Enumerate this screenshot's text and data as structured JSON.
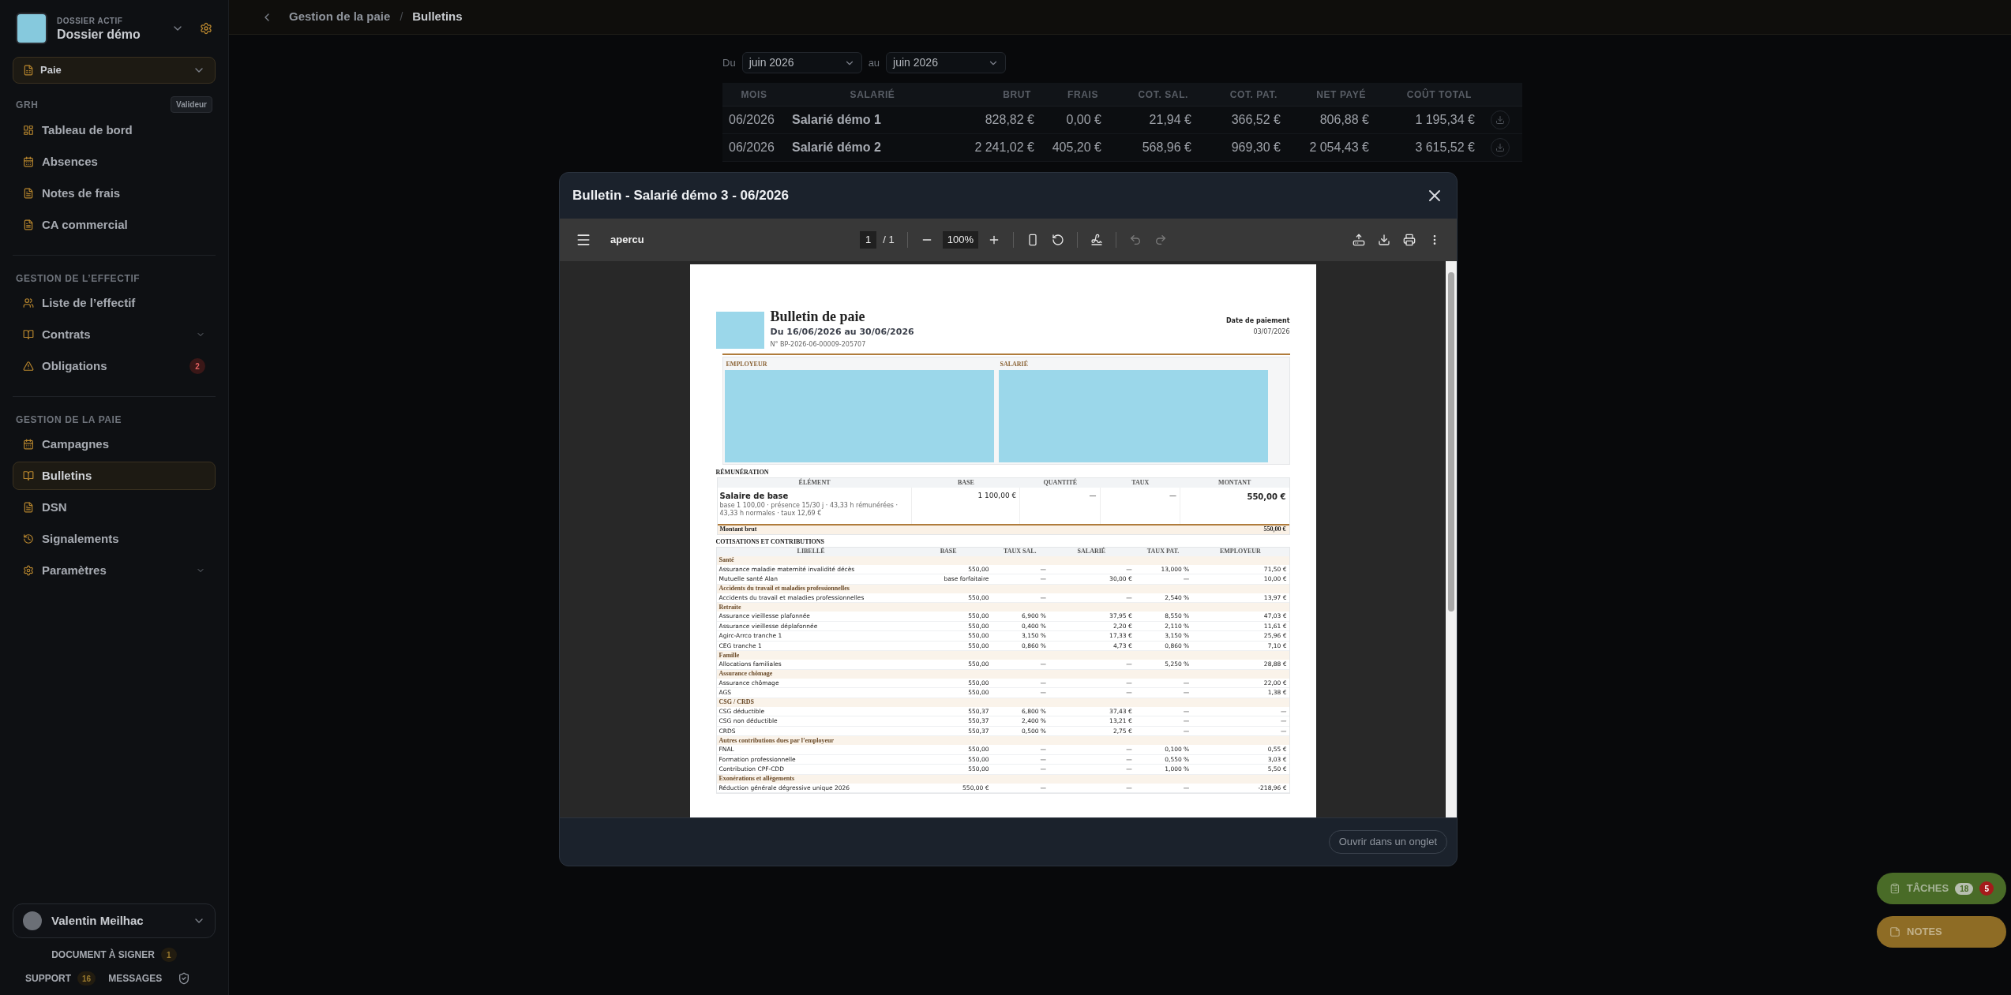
{
  "sidebar": {
    "workspace_label": "DOSSIER ACTIF",
    "workspace_name": "Dossier démo",
    "module": "Paie",
    "sections": [
      {
        "title": "GRH",
        "badge": "Valideur",
        "items": [
          {
            "label": "Tableau de bord",
            "kind": "link",
            "selected": false
          },
          {
            "label": "Absences",
            "kind": "link",
            "selected": false
          },
          {
            "label": "Notes de frais",
            "kind": "link",
            "selected": false
          },
          {
            "label": "CA commercial",
            "kind": "link",
            "selected": false
          }
        ]
      },
      {
        "title": "GESTION DE L’EFFECTIF",
        "items": [
          {
            "label": "Liste de l’effectif",
            "kind": "link",
            "selected": false
          },
          {
            "label": "Contrats",
            "kind": "group",
            "expanded": false,
            "selected": false
          },
          {
            "label": "Obligations",
            "kind": "link",
            "badge": "2",
            "selected": false
          }
        ]
      },
      {
        "title": "GESTION DE LA PAIE",
        "items": [
          {
            "label": "Campagnes",
            "kind": "link",
            "selected": false
          },
          {
            "label": "Bulletins",
            "kind": "link",
            "selected": true
          },
          {
            "label": "DSN",
            "kind": "link",
            "selected": false
          },
          {
            "label": "Signalements",
            "kind": "link",
            "selected": false
          },
          {
            "label": "Paramètres",
            "kind": "group",
            "expanded": false,
            "selected": false
          }
        ]
      }
    ],
    "user": "Valentin Meilhac",
    "sign": {
      "label": "DOCUMENT À SIGNER",
      "count": "1"
    },
    "support": {
      "label": "SUPPORT",
      "count": "16"
    },
    "messages": {
      "label": "MESSAGES"
    }
  },
  "breadcrumb": [
    "Gestion de la paie",
    "/",
    "Bulletins"
  ],
  "filters": {
    "from_label": "Du",
    "from": "juin 2026",
    "to_label": "au",
    "to": "juin 2026"
  },
  "table": {
    "columns": [
      "MOIS",
      "SALARIÉ",
      "BRUT",
      "FRAIS",
      "COT. SAL.",
      "COT. PAT.",
      "NET PAYÉ",
      "COÛT TOTAL"
    ],
    "rows": [
      [
        "06/2026",
        "Salarié démo 1",
        "828,82 €",
        "0,00 €",
        "21,94 €",
        "366,52 €",
        "806,88 €",
        "1 195,34 €"
      ],
      [
        "06/2026",
        "Salarié démo 2",
        "2 241,02 €",
        "405,20 €",
        "568,96 €",
        "969,30 €",
        "2 054,43 €",
        "3 615,52 €"
      ]
    ]
  },
  "modal": {
    "title": "Bulletin - Salarié démo 3 - 06/2026",
    "viewer": {
      "file": "apercu",
      "page": "1",
      "pages": "/ 1",
      "zoom": "100%"
    },
    "document": {
      "title": "Bulletin de paie",
      "period": "Du 16/06/2026 au 30/06/2026",
      "number": "N° BP-2026-06-00009-205707",
      "payment_label": "Date de paiement",
      "payment_date": "03/07/2026",
      "employer_label": "EMPLOYEUR",
      "employee_label": "SALARIÉ",
      "remuneration": {
        "title": "RÉMUNÉRATION",
        "columns": [
          "ÉLÉMENT",
          "BASE",
          "QUANTITÉ",
          "TAUX",
          "MONTANT"
        ],
        "rows": [
          {
            "element": "Salaire de base",
            "detail": "base 1 100,00 · présence 15/30 j · 43,33 h rémunérées · 43,33 h normales · taux 12,69 €",
            "base": "1 100,00 €",
            "quantity": "—",
            "rate": "—",
            "amount": "550,00 €"
          }
        ],
        "total_label": "Montant brut",
        "total": "550,00 €"
      },
      "contributions": {
        "title": "COTISATIONS ET CONTRIBUTIONS",
        "columns": [
          "LIBELLÉ",
          "BASE",
          "TAUX SAL.",
          "SALARIÉ",
          "TAUX PAT.",
          "EMPLOYEUR"
        ],
        "rows": [
          {
            "kind": "section",
            "label": "Santé"
          },
          {
            "kind": "line",
            "cells": [
              "Assurance maladie maternité invalidité décès",
              "550,00",
              "—",
              "—",
              "13,000 %",
              "71,50 €"
            ]
          },
          {
            "kind": "line",
            "cells": [
              "Mutuelle santé Alan",
              "base forfaitaire",
              "—",
              "30,00 €",
              "—",
              "10,00 €"
            ]
          },
          {
            "kind": "section",
            "label": "Accidents du travail et maladies professionnelles"
          },
          {
            "kind": "line",
            "cells": [
              "Accidents du travail et maladies professionnelles",
              "550,00",
              "—",
              "—",
              "2,540 %",
              "13,97 €"
            ]
          },
          {
            "kind": "section",
            "label": "Retraite"
          },
          {
            "kind": "line",
            "cells": [
              "Assurance vieillesse plafonnée",
              "550,00",
              "6,900 %",
              "37,95 €",
              "8,550 %",
              "47,03 €"
            ]
          },
          {
            "kind": "line",
            "cells": [
              "Assurance vieillesse déplafonnée",
              "550,00",
              "0,400 %",
              "2,20 €",
              "2,110 %",
              "11,61 €"
            ]
          },
          {
            "kind": "line",
            "cells": [
              "Agirc-Arrco tranche 1",
              "550,00",
              "3,150 %",
              "17,33 €",
              "3,150 %",
              "25,96 €"
            ]
          },
          {
            "kind": "line",
            "cells": [
              "CEG tranche 1",
              "550,00",
              "0,860 %",
              "4,73 €",
              "0,860 %",
              "7,10 €"
            ]
          },
          {
            "kind": "section",
            "label": "Famille"
          },
          {
            "kind": "line",
            "cells": [
              "Allocations familiales",
              "550,00",
              "—",
              "—",
              "5,250 %",
              "28,88 €"
            ]
          },
          {
            "kind": "section",
            "label": "Assurance chômage"
          },
          {
            "kind": "line",
            "cells": [
              "Assurance chômage",
              "550,00",
              "—",
              "—",
              "—",
              "22,00 €"
            ]
          },
          {
            "kind": "line",
            "cells": [
              "AGS",
              "550,00",
              "—",
              "—",
              "—",
              "1,38 €"
            ]
          },
          {
            "kind": "section",
            "label": "CSG / CRDS"
          },
          {
            "kind": "line",
            "cells": [
              "CSG déductible",
              "550,37",
              "6,800 %",
              "37,43 €",
              "—",
              "—"
            ]
          },
          {
            "kind": "line",
            "cells": [
              "CSG non déductible",
              "550,37",
              "2,400 %",
              "13,21 €",
              "—",
              "—"
            ]
          },
          {
            "kind": "line",
            "cells": [
              "CRDS",
              "550,37",
              "0,500 %",
              "2,75 €",
              "—",
              "—"
            ]
          },
          {
            "kind": "section",
            "label": "Autres contributions dues par l’employeur"
          },
          {
            "kind": "line",
            "cells": [
              "FNAL",
              "550,00",
              "—",
              "—",
              "0,100 %",
              "0,55 €"
            ]
          },
          {
            "kind": "line",
            "cells": [
              "Formation professionnelle",
              "550,00",
              "—",
              "—",
              "0,550 %",
              "3,03 €"
            ]
          },
          {
            "kind": "line",
            "cells": [
              "Contribution CPF-CDD",
              "550,00",
              "—",
              "—",
              "1,000 %",
              "5,50 €"
            ]
          },
          {
            "kind": "section",
            "label": "Exonérations et allègements"
          },
          {
            "kind": "line",
            "cells": [
              "Réduction générale dégressive unique 2026",
              "550,00 €",
              "—",
              "—",
              "—",
              "-218,96 €"
            ]
          }
        ]
      }
    },
    "open_button": "Ouvrir dans un onglet"
  },
  "floating": {
    "tasks": {
      "label": "TÂCHES",
      "count": "18",
      "alert": "5"
    },
    "notes": {
      "label": "NOTES"
    }
  }
}
